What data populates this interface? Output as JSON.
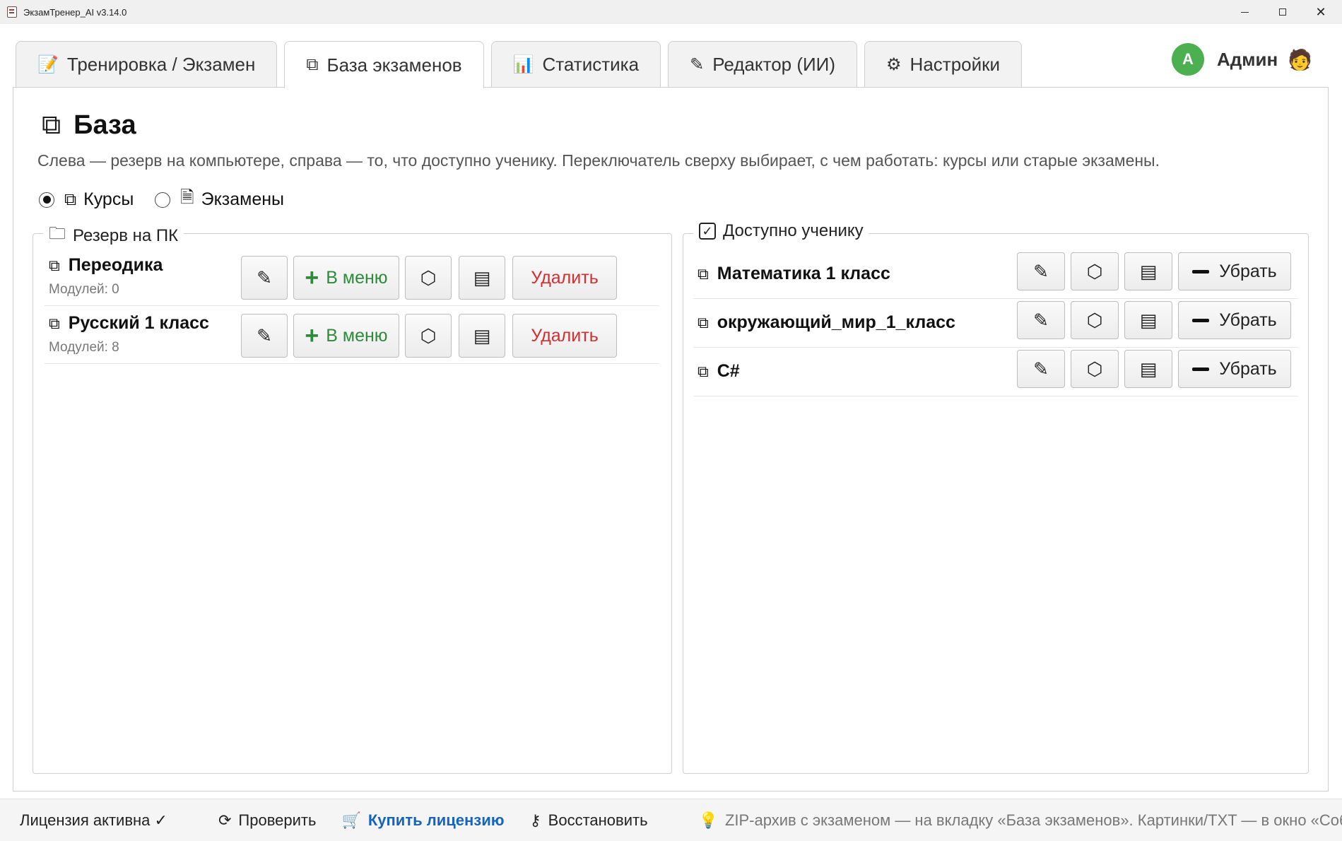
{
  "window": {
    "title": "ЭкзамТренер_AI v3.14.0",
    "close_glyph": "✕"
  },
  "tabs": [
    {
      "label": "Тренировка / Экзамен",
      "icon": "exam-icon",
      "glyph": "📝",
      "active": false
    },
    {
      "label": "База экзаменов",
      "icon": "database-icon",
      "glyph": "⧉",
      "active": true
    },
    {
      "label": "Статистика",
      "icon": "chart-icon",
      "glyph": "📊",
      "active": false
    },
    {
      "label": "Редактор (ИИ)",
      "icon": "pencil-icon",
      "glyph": "✎",
      "active": false
    },
    {
      "label": "Настройки",
      "icon": "gear-icon",
      "glyph": "⚙",
      "active": false
    }
  ],
  "user": {
    "avatar_letter": "A",
    "name": "Админ",
    "avatar_color": "#4caf50",
    "emoji": "🧑"
  },
  "page": {
    "icon": "⧉",
    "title": "База",
    "description": "Слева — резерв на компьютере, справа — то, что доступно ученику. Переключатель сверху выбирает, с чем работать: курсы или старые экзамены."
  },
  "mode": {
    "options": [
      {
        "label": "Курсы",
        "icon": "⧉",
        "selected": true
      },
      {
        "label": "Экзамены",
        "icon": "🗎",
        "selected": false
      }
    ]
  },
  "reserve": {
    "title": "Резерв на ПК",
    "icon": "🗀",
    "items": [
      {
        "name": "Переодика",
        "modules": "Модулей: 0"
      },
      {
        "name": "Русский 1 класс",
        "modules": "Модулей: 8"
      }
    ],
    "buttons": {
      "edit_glyph": "✎",
      "to_menu": "В меню",
      "to_menu_glyph": "+",
      "pack_glyph": "⬡",
      "archive_glyph": "▤",
      "delete": "Удалить"
    }
  },
  "available": {
    "title": "Доступно ученику",
    "check_glyph": "✓",
    "items": [
      {
        "name": "Математика 1 класс"
      },
      {
        "name": "окружающий_мир_1_класс"
      },
      {
        "name": "C#"
      }
    ],
    "buttons": {
      "edit_glyph": "✎",
      "pack_glyph": "⬡",
      "archive_glyph": "▤",
      "remove": "Убрать"
    }
  },
  "status": {
    "license": "Лицензия активна ✓",
    "check": "Проверить",
    "buy": "Купить лицензию",
    "restore": "Восстановить",
    "hint": "ZIP-архив с экзаменом — на вкладку «База экзаменов». Картинки/TXT — в окно «Собрать экзаме",
    "colors": {
      "led": "#2e9e3f",
      "link": "#1565c0",
      "add": "#2e8b3a",
      "delete": "#d32f2f"
    }
  }
}
